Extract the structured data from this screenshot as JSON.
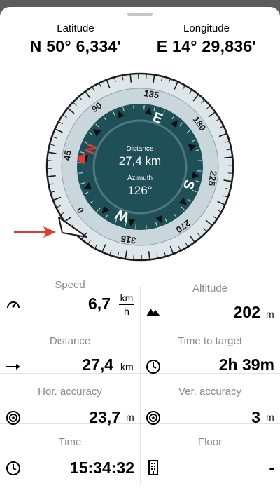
{
  "coordinates": {
    "latitude_label": "Latitude",
    "latitude_value": "N 50° 6,334'",
    "longitude_label": "Longitude",
    "longitude_value": "E 14° 29,836'"
  },
  "compass": {
    "ring_labels": [
      "0",
      "45",
      "90",
      "135",
      "180",
      "225",
      "270",
      "315"
    ],
    "cardinals": [
      "N",
      "E",
      "S",
      "W"
    ],
    "distance_label": "Distance",
    "distance_value": "27,4 km",
    "azimuth_label": "Azimuth",
    "azimuth_value": "126°",
    "colors": {
      "dial": "#1f4f57",
      "ring": "#c9d6dc",
      "north": "#e53935",
      "arrow": "#e53935"
    }
  },
  "stats": {
    "speed": {
      "label": "Speed",
      "value": "6,7",
      "unit_top": "km",
      "unit_bottom": "h",
      "icon": "speedometer-icon"
    },
    "altitude": {
      "label": "Altitude",
      "value": "202",
      "unit": "m",
      "icon": "mountain-icon"
    },
    "distance": {
      "label": "Distance",
      "value": "27,4",
      "unit": "km",
      "icon": "arrow-right-icon"
    },
    "time_to_target": {
      "label": "Time to target",
      "value": "2h 39m",
      "icon": "clock-icon"
    },
    "hor_accuracy": {
      "label": "Hor. accuracy",
      "value": "23,7",
      "unit": "m",
      "icon": "target-icon"
    },
    "ver_accuracy": {
      "label": "Ver. accuracy",
      "value": "3",
      "unit": "m",
      "icon": "target-icon"
    },
    "time": {
      "label": "Time",
      "value": "15:34:32",
      "icon": "clock-icon"
    },
    "floor": {
      "label": "Floor",
      "value": "-",
      "icon": "building-icon"
    }
  }
}
